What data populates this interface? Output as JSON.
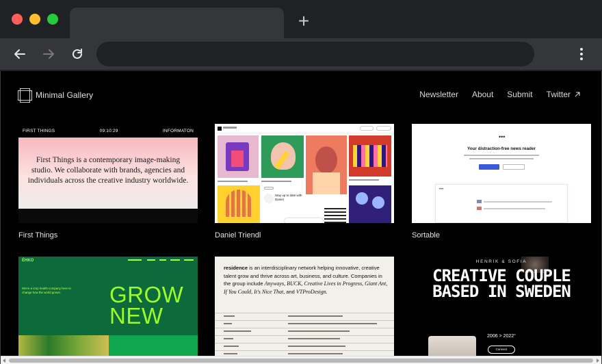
{
  "browser": {
    "new_tab_glyph": "+",
    "icons": [
      "back-arrow-icon",
      "forward-arrow-icon",
      "reload-icon",
      "kebab-menu-icon"
    ]
  },
  "site": {
    "name": "Minimal Gallery",
    "nav": [
      {
        "label": "Newsletter"
      },
      {
        "label": "About"
      },
      {
        "label": "Submit"
      },
      {
        "label": "Twitter",
        "icon": "arrow-up-right-icon"
      }
    ]
  },
  "cards": [
    {
      "label": "First Things",
      "bar_left": "FIRST THINGS",
      "bar_mid": "09:10:29",
      "bar_right": "INFORMATON",
      "hero_text": "First Things is a contemporary image-making studio. We collaborate with brands, agencies and individuals across the creative industry worldwide."
    },
    {
      "label": "Daniel Triendl",
      "promo": "Stay up to date with Daniel"
    },
    {
      "label": "Sortable",
      "headline": "Your distraction-free news reader",
      "dots": "•••"
    },
    {
      "label": "",
      "logo": "ÉHKO",
      "headline_1": "GROW",
      "headline_2": "NEW",
      "blurb": "We're a crop health company here to change how the world grows."
    },
    {
      "label": "",
      "brand": "residence",
      "text_1": " is an interdisciplinary network helping innovative, creative talent grow and thrive across art, business, and culture. Companies in the group include ",
      "italic_1": "Anyways, BUCK, Creative Lives in Progress, Giant Ant, If You Could, It's Nice That,",
      "text_2": " and ",
      "italic_2": "VTProDesign."
    },
    {
      "label": "",
      "names": "HENRIK & SOFIA",
      "headline": "CREATIVE COUPLE BASED IN SWEDEN",
      "years": "2006 > 2022°",
      "button": "Connect"
    }
  ],
  "colors": {
    "page_bg": "#000000",
    "grow_green": "#9cfb2a",
    "sortable_button": "#3a5bd9"
  }
}
